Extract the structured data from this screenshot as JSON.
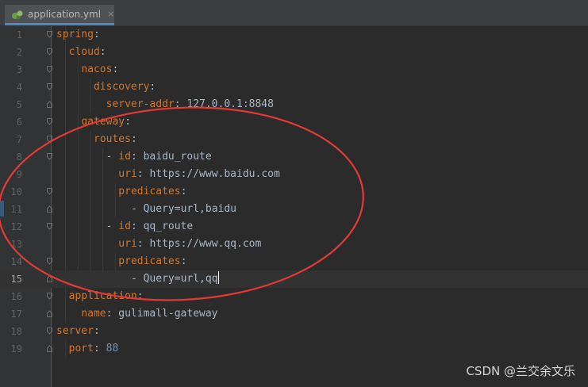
{
  "tab": {
    "filename": "application.yml",
    "close_glyph": "×"
  },
  "editor": {
    "current_line": 15,
    "lines": [
      {
        "n": "1",
        "indent": 0,
        "key": "spring",
        "sep": ":",
        "value": "",
        "value_type": ""
      },
      {
        "n": "2",
        "indent": 1,
        "key": "cloud",
        "sep": ":",
        "value": "",
        "value_type": ""
      },
      {
        "n": "3",
        "indent": 2,
        "key": "nacos",
        "sep": ":",
        "value": "",
        "value_type": ""
      },
      {
        "n": "4",
        "indent": 3,
        "key": "discovery",
        "sep": ":",
        "value": "",
        "value_type": ""
      },
      {
        "n": "5",
        "indent": 4,
        "key": "server-addr",
        "sep": ": ",
        "value": "127.0.0.1:8848",
        "value_type": "val"
      },
      {
        "n": "6",
        "indent": 2,
        "key": "gateway",
        "sep": ":",
        "value": "",
        "value_type": ""
      },
      {
        "n": "7",
        "indent": 3,
        "key": "routes",
        "sep": ":",
        "value": "",
        "value_type": ""
      },
      {
        "n": "8",
        "indent": 4,
        "prefix": "- ",
        "key": "id",
        "sep": ": ",
        "value": "baidu_route",
        "value_type": "val"
      },
      {
        "n": "9",
        "indent": 5,
        "key": "uri",
        "sep": ": ",
        "value": "https://www.baidu.com",
        "value_type": "val"
      },
      {
        "n": "10",
        "indent": 5,
        "key": "predicates",
        "sep": ":",
        "value": "",
        "value_type": ""
      },
      {
        "n": "11",
        "indent": 6,
        "prefix": "- ",
        "key": "",
        "sep": "",
        "value": "Query=url,baidu",
        "value_type": "val"
      },
      {
        "n": "12",
        "indent": 4,
        "prefix": "- ",
        "key": "id",
        "sep": ": ",
        "value": "qq_route",
        "value_type": "val"
      },
      {
        "n": "13",
        "indent": 5,
        "key": "uri",
        "sep": ": ",
        "value": "https://www.qq.com",
        "value_type": "val"
      },
      {
        "n": "14",
        "indent": 5,
        "key": "predicates",
        "sep": ":",
        "value": "",
        "value_type": ""
      },
      {
        "n": "15",
        "indent": 6,
        "prefix": "- ",
        "key": "",
        "sep": "",
        "value": "Query=url,qq",
        "value_type": "val"
      },
      {
        "n": "16",
        "indent": 1,
        "key": "application",
        "sep": ":",
        "value": "",
        "value_type": ""
      },
      {
        "n": "17",
        "indent": 2,
        "key": "name",
        "sep": ": ",
        "value": "gulimall-gateway",
        "value_type": "val"
      },
      {
        "n": "18",
        "indent": 0,
        "key": "server",
        "sep": ":",
        "value": "",
        "value_type": ""
      },
      {
        "n": "19",
        "indent": 1,
        "key": "port",
        "sep": ": ",
        "value": "88",
        "value_type": "num"
      }
    ]
  },
  "colors": {
    "key": "#cc7832",
    "number": "#6897bb",
    "text": "#a9b7c6",
    "annotation": "#e53935",
    "tab_underline": "#4a88c7"
  },
  "icons": {
    "tab_file": "yaml-file-icon",
    "fold": "fold-marker-icon"
  },
  "watermark": "CSDN @兰交余文乐"
}
